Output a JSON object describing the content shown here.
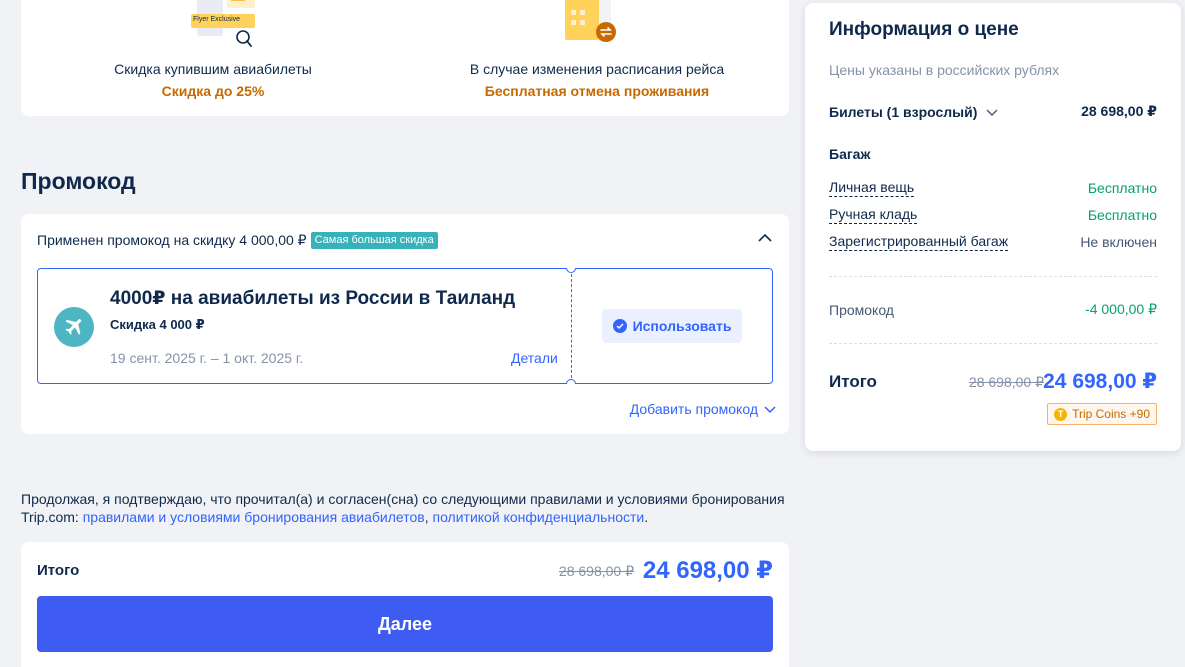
{
  "colors": {
    "accent": "#3264ff",
    "button": "#3f5cf2",
    "discount_text": "#c66a00",
    "free_text": "#06a16e",
    "badge": "#38b2ba"
  },
  "benefits": [
    {
      "illustration_label": "Flyer Exclusive",
      "title": "Скидка купившим авиабилеты",
      "subtitle": "Скидка до 25%"
    },
    {
      "title": "В случае изменения расписания рейса",
      "subtitle": "Бесплатная отмена проживания"
    }
  ],
  "promo": {
    "heading": "Промокод",
    "applied_text": "Применен промокод на скидку 4 000,00 ₽",
    "badge": "Самая большая скидка",
    "coupon": {
      "title": "4000₽ на авиабилеты из России в Таиланд",
      "discount": "Скидка 4 000 ₽",
      "dates": "19 сент. 2025 г. – 1 окт. 2025 г.",
      "details_label": "Детали",
      "use_label": "Использовать"
    },
    "add_label": "Добавить промокод"
  },
  "consent": {
    "text": "Продолжая, я подтверждаю, что прочитал(а) и согласен(сна) со следующими правилами и условиями бронирования Trip.com: ",
    "link_rules": "правилами и условиями бронирования авиабилетов",
    "separator": ", ",
    "link_privacy": "политикой конфиденциальности",
    "end": "."
  },
  "bottom": {
    "total_label": "Итого",
    "old_price": "28 698,00 ₽",
    "new_price": "24 698,00 ₽",
    "next_label": "Далее"
  },
  "price_info": {
    "title": "Информация о цене",
    "note": "Цены указаны в российских рублях",
    "tickets_label": "Билеты (1 взрослый)",
    "tickets_value": "28 698,00 ₽",
    "baggage_label": "Багаж",
    "baggage": [
      {
        "label": "Личная вещь",
        "value": "Бесплатно"
      },
      {
        "label": "Ручная кладь",
        "value": "Бесплатно"
      },
      {
        "label": "Зарегистрированный багаж",
        "value": "Не включен"
      }
    ],
    "promo_label": "Промокод",
    "promo_value": "-4 000,00 ₽",
    "total_label": "Итого",
    "old_total": "28 698,00 ₽",
    "new_total": "24 698,00 ₽",
    "coins": "Trip Coins +90"
  }
}
